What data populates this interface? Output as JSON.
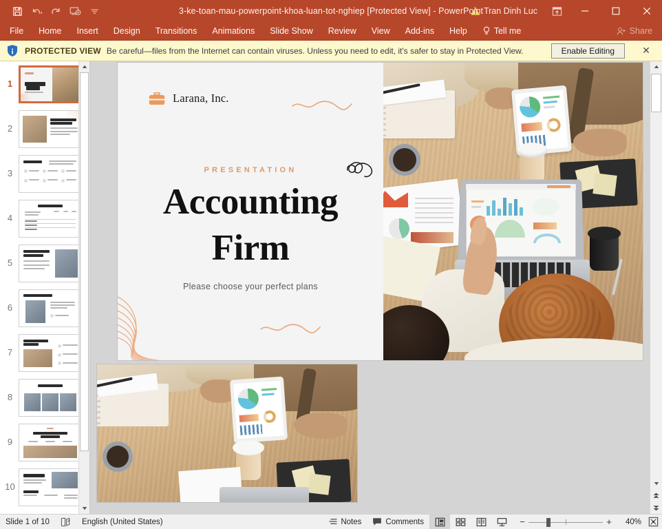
{
  "window": {
    "title": "3-ke-toan-mau-powerpoint-khoa-luan-tot-nghiep [Protected View]  -  PowerPoint",
    "account_name": "Tran Dinh Luc",
    "quick_access": [
      {
        "name": "save",
        "label": "Save"
      },
      {
        "name": "undo",
        "label": "Undo"
      },
      {
        "name": "redo",
        "label": "Redo"
      },
      {
        "name": "start-from-beginning",
        "label": "Start From Beginning"
      },
      {
        "name": "customize",
        "label": "Customize Quick Access Toolbar"
      }
    ],
    "controls": {
      "ribbon_display": "Ribbon Display Options",
      "minimize": "Minimize",
      "maximize": "Maximize",
      "close": "Close"
    }
  },
  "ribbon": {
    "tabs": [
      "File",
      "Home",
      "Insert",
      "Design",
      "Transitions",
      "Animations",
      "Slide Show",
      "Review",
      "View",
      "Add-ins",
      "Help"
    ],
    "tell_me": "Tell me",
    "share": "Share"
  },
  "protected_view": {
    "label": "PROTECTED VIEW",
    "message": "Be careful—files from the Internet can contain viruses. Unless you need to edit, it's safer to stay in Protected View.",
    "enable_button": "Enable Editing",
    "close": "✕"
  },
  "thumbnails": [
    {
      "number": "1",
      "active": true
    },
    {
      "number": "2",
      "active": false
    },
    {
      "number": "3",
      "active": false
    },
    {
      "number": "4",
      "active": false
    },
    {
      "number": "5",
      "active": false
    },
    {
      "number": "6",
      "active": false
    },
    {
      "number": "7",
      "active": false
    },
    {
      "number": "8",
      "active": false
    },
    {
      "number": "9",
      "active": false
    },
    {
      "number": "10",
      "active": false
    }
  ],
  "slide": {
    "brand": "Larana, Inc.",
    "kicker": "PRESENTATION",
    "title_line1": "Accounting",
    "title_line2": "Firm",
    "subtitle": "Please choose your perfect plans"
  },
  "status_bar": {
    "slide_counter": "Slide 1 of 10",
    "accessibility": "Accessibility Checker",
    "language": "English (United States)",
    "notes": "Notes",
    "comments": "Comments",
    "views": [
      {
        "name": "normal",
        "label": "Normal",
        "active": true
      },
      {
        "name": "slide-sorter",
        "label": "Slide Sorter",
        "active": false
      },
      {
        "name": "reading-view",
        "label": "Reading View",
        "active": false
      },
      {
        "name": "slide-show",
        "label": "Slide Show",
        "active": false
      }
    ],
    "zoom_out": "−",
    "zoom_in": "+",
    "zoom_level": "40%",
    "fit_window": "Fit slide to current window"
  },
  "colors": {
    "accent": "#b7472a",
    "slide_accent": "#e09a63",
    "protected_bar": "#fdf8cd",
    "selected_thumb_border": "#d2693f"
  }
}
